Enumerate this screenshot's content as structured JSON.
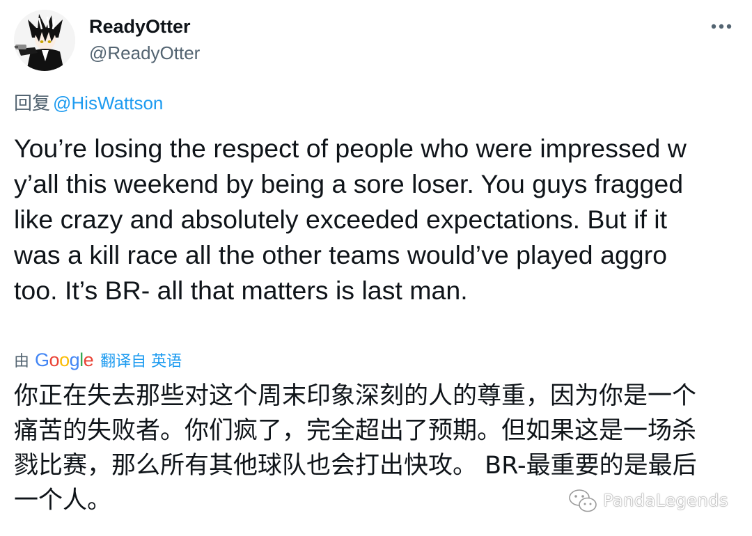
{
  "user": {
    "display_name": "ReadyOtter",
    "handle": "@ReadyOtter"
  },
  "reply": {
    "prefix": "回复",
    "mention": "@HisWattson"
  },
  "tweet": {
    "text": "You’re losing the respect of people who were impressed w y’all this weekend by being a sore loser. You guys fragged like crazy and absolutely exceeded expectations. But if it was a kill race all the other teams would’ve played aggro too. It’s BR- all that matters is last man."
  },
  "translation": {
    "by_label": "由",
    "provider": "Google",
    "link_text": "翻译自 英语",
    "text": "你正在失去那些对这个周末印象深刻的人的尊重，因为你是一个痛苦的失败者。你们疯了，完全超出了预期。但如果这是一场杀戮比赛，那么所有其他球队也会打出快攻。 BR-最重要的是最后一个人。"
  },
  "watermark": {
    "text": "PandaLegends"
  },
  "icons": {
    "more": "more-horizontal-icon",
    "watermark": "wechat-icon"
  },
  "colors": {
    "text_primary": "#0f1419",
    "text_secondary": "#536471",
    "link": "#1d9bf0",
    "google_blue": "#4285F4",
    "google_red": "#EA4335",
    "google_yellow": "#FBBC05",
    "google_green": "#34A853"
  }
}
